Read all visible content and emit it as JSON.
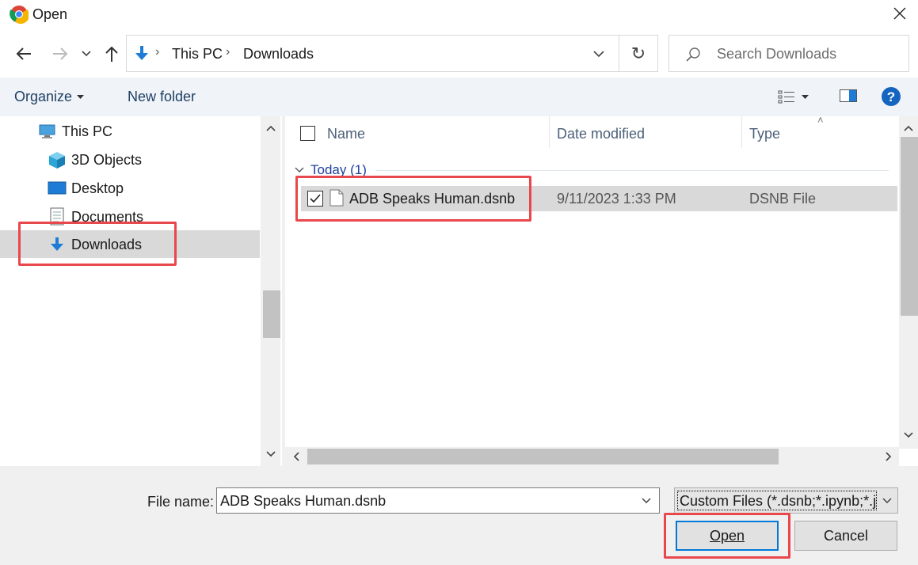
{
  "window": {
    "title": "Open",
    "app_icon": "chrome-icon"
  },
  "nav": {
    "breadcrumbs": [
      "This PC",
      "Downloads"
    ],
    "search_placeholder": "Search Downloads"
  },
  "toolbar": {
    "organize_label": "Organize",
    "new_folder_label": "New folder"
  },
  "sidebar": {
    "items": [
      {
        "label": "This PC",
        "icon": "computer-icon"
      },
      {
        "label": "3D Objects",
        "icon": "cube-icon"
      },
      {
        "label": "Desktop",
        "icon": "desktop-icon"
      },
      {
        "label": "Documents",
        "icon": "documents-icon"
      },
      {
        "label": "Downloads",
        "icon": "download-arrow-icon",
        "selected": true
      }
    ]
  },
  "file_list": {
    "columns": [
      "Name",
      "Date modified",
      "Type"
    ],
    "group_label": "Today (1)",
    "files": [
      {
        "name": "ADB Speaks Human.dsnb",
        "date_modified": "9/11/2023 1:33 PM",
        "type": "DSNB File",
        "checked": true,
        "selected": true
      }
    ]
  },
  "footer": {
    "file_name_label": "File name:",
    "file_name_value": "ADB Speaks Human.dsnb",
    "filter_value": "Custom Files (*.dsnb;*.ipynb;*.js",
    "open_label": "Open",
    "cancel_label": "Cancel"
  },
  "colors": {
    "accent": "#0078d7",
    "highlight_box": "#e8474c",
    "selection_bg": "#d9d9d9",
    "command_bar_bg": "#f0f4f9"
  }
}
